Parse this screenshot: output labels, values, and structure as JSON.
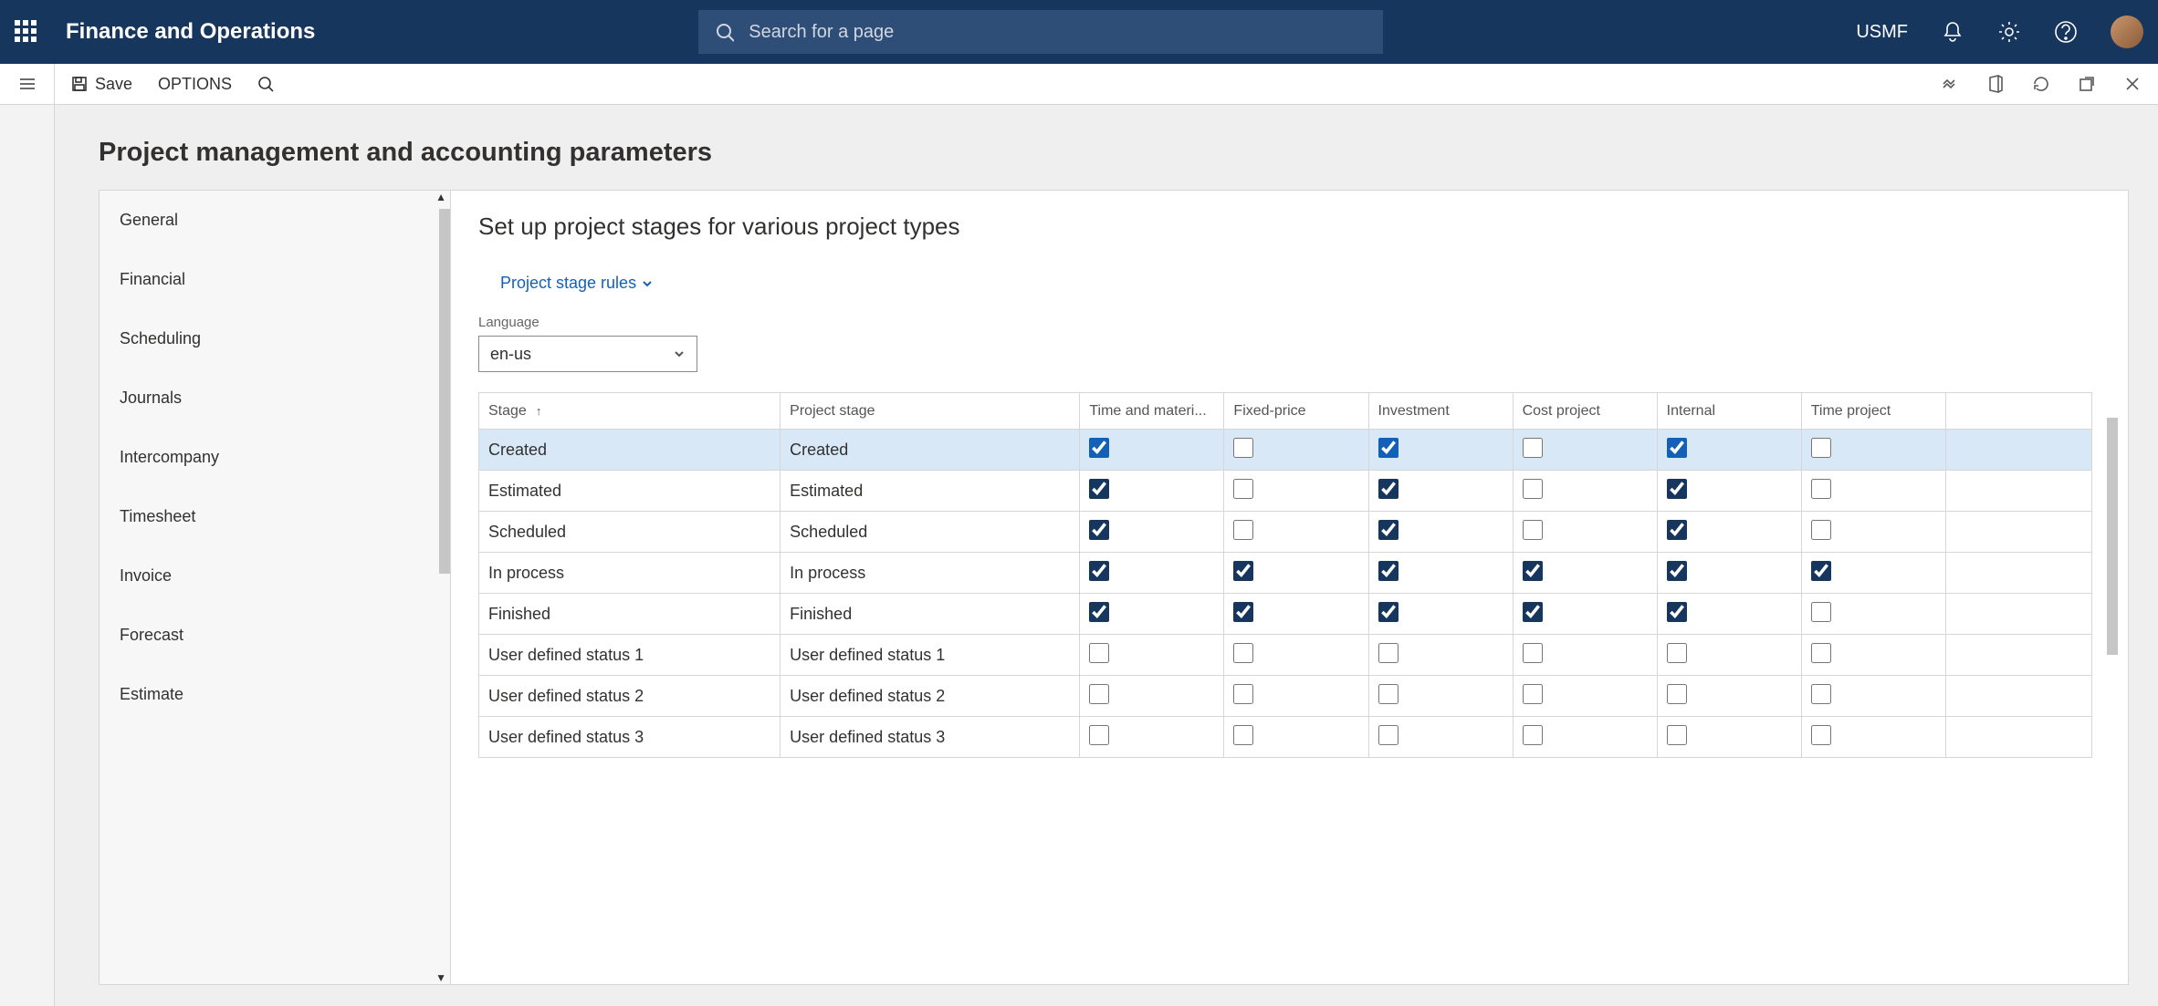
{
  "topbar": {
    "app_title": "Finance and Operations",
    "search_placeholder": "Search for a page",
    "company": "USMF"
  },
  "actionbar": {
    "save": "Save",
    "options": "OPTIONS"
  },
  "page": {
    "title": "Project management and accounting parameters"
  },
  "sidenav": {
    "items": [
      "General",
      "Financial",
      "Scheduling",
      "Journals",
      "Intercompany",
      "Timesheet",
      "Invoice",
      "Forecast",
      "Estimate"
    ]
  },
  "main": {
    "heading": "Set up project stages for various project types",
    "rules_link": "Project stage rules",
    "language_label": "Language",
    "language_value": "en-us"
  },
  "grid": {
    "columns": [
      "Stage",
      "Project stage",
      "Time and materi...",
      "Fixed-price",
      "Investment",
      "Cost project",
      "Internal",
      "Time project"
    ],
    "sort_column": 0,
    "sort_dir": "asc",
    "rows": [
      {
        "stage": "Created",
        "label": "Created",
        "chk": [
          true,
          false,
          true,
          false,
          true,
          false
        ],
        "selected": true
      },
      {
        "stage": "Estimated",
        "label": "Estimated",
        "chk": [
          true,
          false,
          true,
          false,
          true,
          false
        ]
      },
      {
        "stage": "Scheduled",
        "label": "Scheduled",
        "chk": [
          true,
          false,
          true,
          false,
          true,
          false
        ]
      },
      {
        "stage": "In process",
        "label": "In process",
        "chk": [
          true,
          true,
          true,
          true,
          true,
          true
        ]
      },
      {
        "stage": "Finished",
        "label": "Finished",
        "chk": [
          true,
          true,
          true,
          true,
          true,
          false
        ]
      },
      {
        "stage": "User defined status 1",
        "label": "User defined status 1",
        "chk": [
          false,
          false,
          false,
          false,
          false,
          false
        ]
      },
      {
        "stage": "User defined status 2",
        "label": "User defined status 2",
        "chk": [
          false,
          false,
          false,
          false,
          false,
          false
        ]
      },
      {
        "stage": "User defined status 3",
        "label": "User defined status 3",
        "chk": [
          false,
          false,
          false,
          false,
          false,
          false
        ]
      }
    ]
  }
}
